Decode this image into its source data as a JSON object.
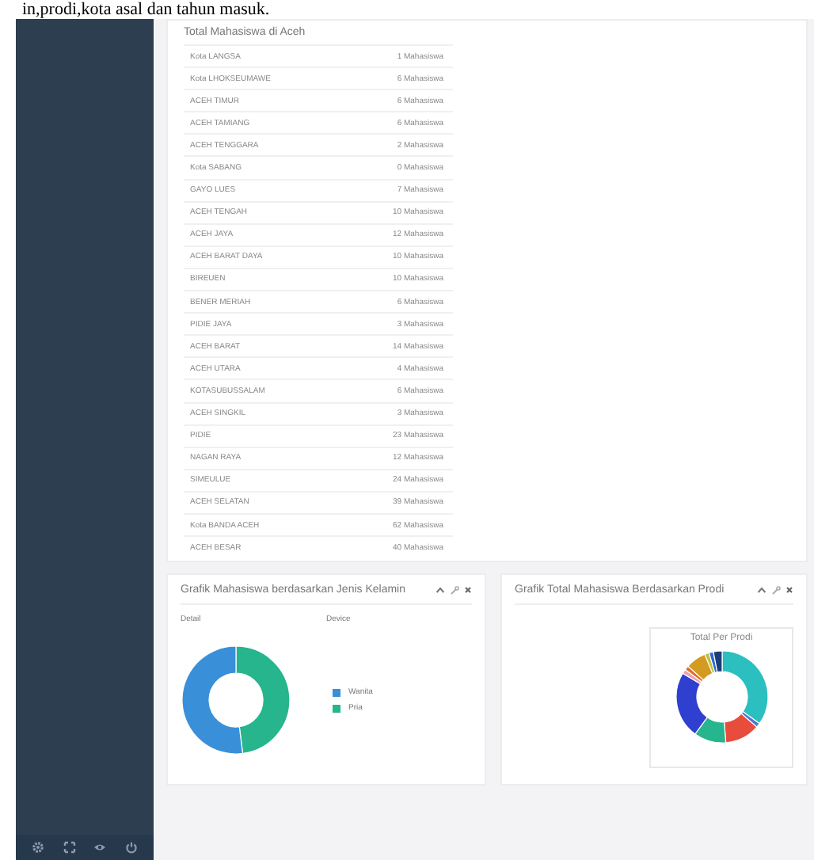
{
  "document_caption": "in,prodi,kota asal dan tahun masuk.",
  "sidebar": {
    "footer_icons": [
      {
        "kind": "gear"
      },
      {
        "kind": "expand"
      },
      {
        "kind": "eye"
      },
      {
        "kind": "power"
      }
    ]
  },
  "city_card": {
    "title": "Total Mahasiswa di Aceh",
    "rows": [
      {
        "city": "Kota LANGSA",
        "count": "1 Mahasiswa"
      },
      {
        "city": "Kota LHOKSEUMAWE",
        "count": "6 Mahasiswa"
      },
      {
        "city": "ACEH TIMUR",
        "count": "6 Mahasiswa"
      },
      {
        "city": "ACEH TAMIANG",
        "count": "6 Mahasiswa"
      },
      {
        "city": "ACEH TENGGARA",
        "count": "2 Mahasiswa"
      },
      {
        "city": "Kota SABANG",
        "count": "0 Mahasiswa"
      },
      {
        "city": "GAYO LUES",
        "count": "7 Mahasiswa"
      },
      {
        "city": "ACEH TENGAH",
        "count": "10 Mahasiswa"
      },
      {
        "city": "ACEH JAYA",
        "count": "12 Mahasiswa"
      },
      {
        "city": "ACEH BARAT DAYA",
        "count": "10 Mahasiswa"
      },
      {
        "city": "BIREUEN",
        "count": "10 Mahasiswa"
      },
      {
        "city": "BENER MERIAH",
        "count": "6 Mahasiswa"
      },
      {
        "city": "PIDIE JAYA",
        "count": "3 Mahasiswa"
      },
      {
        "city": "ACEH BARAT",
        "count": "14 Mahasiswa"
      },
      {
        "city": "ACEH UTARA",
        "count": "4 Mahasiswa"
      },
      {
        "city": "KOTASUBUSSALAM",
        "count": "6 Mahasiswa"
      },
      {
        "city": "ACEH SINGKIL",
        "count": "3 Mahasiswa"
      },
      {
        "city": "PIDIE",
        "count": "23 Mahasiswa"
      },
      {
        "city": "NAGAN RAYA",
        "count": "12 Mahasiswa"
      },
      {
        "city": "SIMEULUE",
        "count": "24 Mahasiswa"
      },
      {
        "city": "ACEH SELATAN",
        "count": "39 Mahasiswa"
      },
      {
        "city": "Kota BANDA ACEH",
        "count": "62 Mahasiswa"
      },
      {
        "city": "ACEH BESAR",
        "count": "40 Mahasiswa"
      }
    ]
  },
  "gender_card": {
    "title": "Grafik Mahasiswa berdasarkan Jenis Kelamin",
    "detail_label": "Detail",
    "device_label": "Device",
    "legend": [
      {
        "label": "Wanita",
        "color": "#3a8fd9"
      },
      {
        "label": "Pria",
        "color": "#26b58c"
      }
    ]
  },
  "prodi_card": {
    "title": "Grafik Total Mahasiswa Berdasarkan Prodi",
    "chart_title": "Total Per Prodi"
  }
}
